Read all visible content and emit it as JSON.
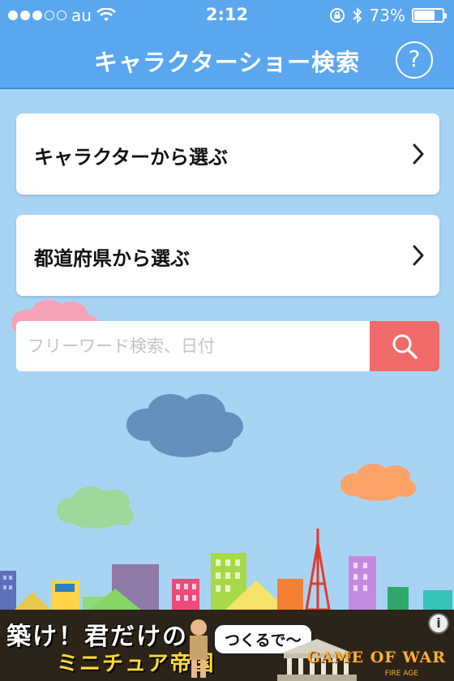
{
  "status_bar": {
    "carrier": "au",
    "time": "2:12",
    "battery": "73%",
    "battery_level": 0.73
  },
  "nav": {
    "title": "キャラクターショー検索",
    "help": "?"
  },
  "menu": {
    "items": [
      {
        "label": "キャラクターから選ぶ"
      },
      {
        "label": "都道府県から選ぶ"
      }
    ]
  },
  "search": {
    "placeholder": "フリーワード検索、日付"
  },
  "ad": {
    "headline": "築け！君だけの",
    "subline": "ミニチュア帝国",
    "bubble": "つくるで〜",
    "brand": "GAME OF WAR",
    "brand_sub": "FIRE AGE",
    "info": "i"
  },
  "colors": {
    "nav_blue": "#5aa7f0",
    "sky": "#a8d4f4",
    "search_button": "#f06a6a"
  },
  "icons": [
    "wifi-icon",
    "lock-rotation-icon",
    "bluetooth-icon",
    "battery-icon",
    "help-icon",
    "chevron-right-icon",
    "search-icon",
    "info-icon"
  ]
}
